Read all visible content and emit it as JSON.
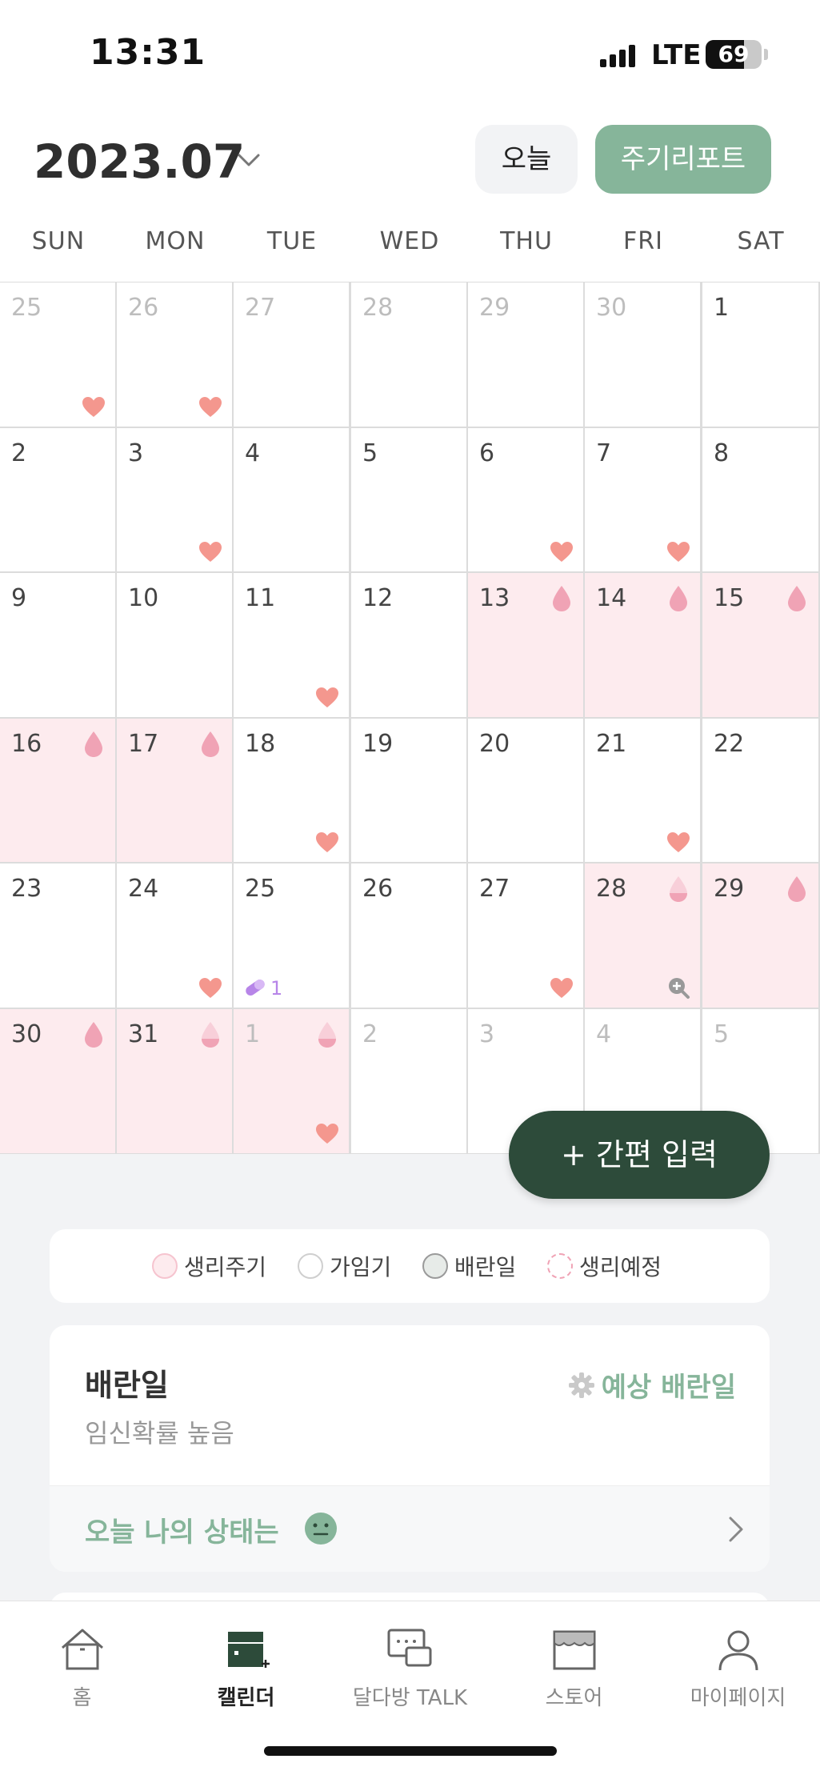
{
  "status_bar": {
    "time": "13:31",
    "network": "LTE",
    "battery_level": "69",
    "battery_fraction": 0.69
  },
  "header": {
    "month": "2023.07",
    "today_label": "오늘",
    "report_label": "주기리포트"
  },
  "weekdays": [
    "SUN",
    "MON",
    "TUE",
    "WED",
    "THU",
    "FRI",
    "SAT"
  ],
  "calendar": {
    "weeks": [
      [
        {
          "day": "25",
          "other": true,
          "heart": true
        },
        {
          "day": "26",
          "other": true,
          "heart": true
        },
        {
          "day": "27",
          "other": true
        },
        {
          "day": "28",
          "other": true
        },
        {
          "day": "29",
          "other": true
        },
        {
          "day": "30",
          "other": true
        },
        {
          "day": "1"
        }
      ],
      [
        {
          "day": "2"
        },
        {
          "day": "3",
          "heart": true
        },
        {
          "day": "4"
        },
        {
          "day": "5"
        },
        {
          "day": "6",
          "heart": true
        },
        {
          "day": "7",
          "heart": true
        },
        {
          "day": "8"
        }
      ],
      [
        {
          "day": "9"
        },
        {
          "day": "10"
        },
        {
          "day": "11",
          "heart": true
        },
        {
          "day": "12"
        },
        {
          "day": "13",
          "period": true,
          "drop": "full"
        },
        {
          "day": "14",
          "period": true,
          "drop": "full"
        },
        {
          "day": "15",
          "period": true,
          "drop": "full"
        }
      ],
      [
        {
          "day": "16",
          "period": true,
          "drop": "full"
        },
        {
          "day": "17",
          "period": true,
          "drop": "full"
        },
        {
          "day": "18",
          "heart": true
        },
        {
          "day": "19"
        },
        {
          "day": "20"
        },
        {
          "day": "21",
          "heart": true
        },
        {
          "day": "22"
        }
      ],
      [
        {
          "day": "23"
        },
        {
          "day": "24",
          "heart": true
        },
        {
          "day": "25",
          "pill": "1"
        },
        {
          "day": "26"
        },
        {
          "day": "27",
          "heart": true
        },
        {
          "day": "28",
          "period": true,
          "drop": "half",
          "zoom": true
        },
        {
          "day": "29",
          "period": true,
          "drop": "full"
        }
      ],
      [
        {
          "day": "30",
          "period": true,
          "drop": "full"
        },
        {
          "day": "31",
          "period": true,
          "drop": "half"
        },
        {
          "day": "1",
          "other": true,
          "period": true,
          "drop": "half",
          "heart": true
        },
        {
          "day": "2",
          "other": true
        },
        {
          "day": "3",
          "other": true
        },
        {
          "day": "4",
          "other": true
        },
        {
          "day": "5",
          "other": true
        }
      ]
    ]
  },
  "quick_input_label": "+ 간편 입력",
  "legend": [
    {
      "label": "생리주기",
      "kind": "period"
    },
    {
      "label": "가임기",
      "kind": "fertile"
    },
    {
      "label": "배란일",
      "kind": "ovulation"
    },
    {
      "label": "생리예정",
      "kind": "expected"
    }
  ],
  "status_card": {
    "title": "배란일",
    "subtitle": "임신확률 높음",
    "predict_label": "예상 배란일",
    "mood_label": "오늘 나의 상태는"
  },
  "bottom_nav": [
    {
      "label": "홈",
      "icon": "home-icon"
    },
    {
      "label": "캘린더",
      "icon": "calendar-icon",
      "active": true
    },
    {
      "label": "달다방 TALK",
      "icon": "chat-icon"
    },
    {
      "label": "스토어",
      "icon": "store-icon"
    },
    {
      "label": "마이페이지",
      "icon": "person-icon"
    }
  ],
  "colors": {
    "accent_green": "#86b59a",
    "dark_green": "#2d4b3a",
    "period_bg": "#fdebee",
    "heart": "#f4978e",
    "drop": "#f0a3b5",
    "pill": "#b785e8"
  }
}
